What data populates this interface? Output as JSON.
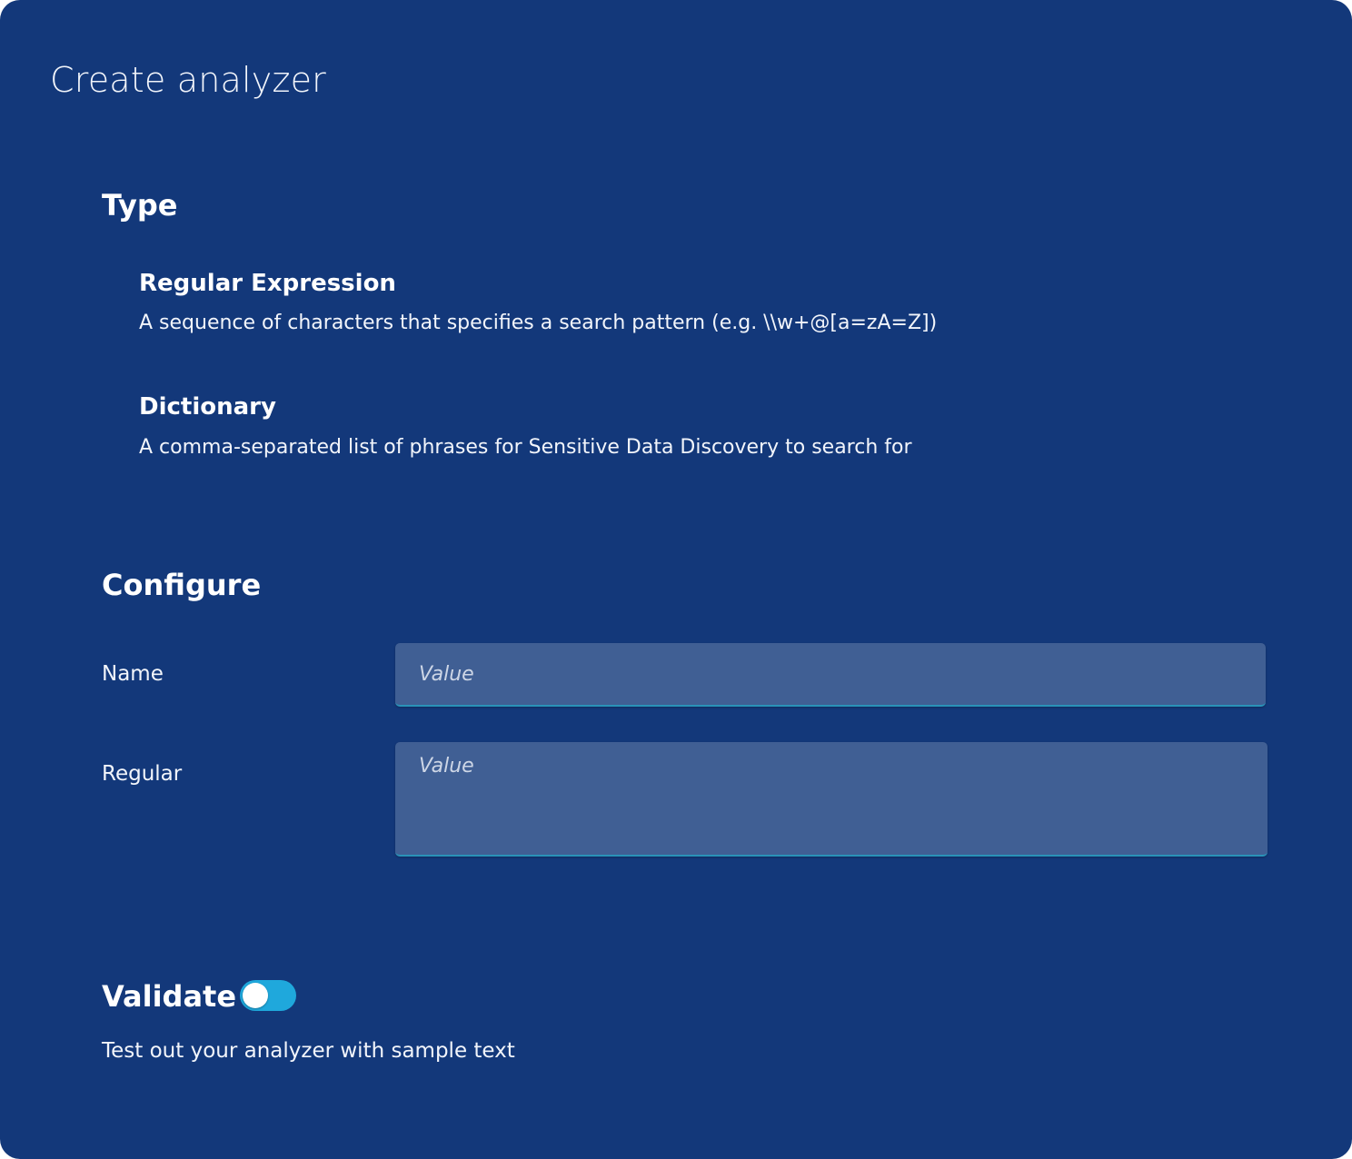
{
  "page": {
    "title": "Create analyzer"
  },
  "type_section": {
    "heading": "Type",
    "options": [
      {
        "title": "Regular Expression",
        "description": "A sequence of characters that specifies a search pattern (e.g. \\\\w+@[a=zA=Z])"
      },
      {
        "title": "Dictionary",
        "description": "A comma-separated list of phrases for Sensitive Data Discovery to search for"
      }
    ]
  },
  "configure_section": {
    "heading": "Configure",
    "name_field": {
      "label": "Name",
      "value": "",
      "placeholder": "Value"
    },
    "regular_field": {
      "label": "Regular",
      "value": "",
      "placeholder": "Value"
    }
  },
  "validate_section": {
    "heading": "Validate",
    "toggle_on": false,
    "description": "Test out your analyzer with sample text"
  },
  "colors": {
    "background": "#13387a",
    "input_background": "#405f94",
    "input_underline": "#2a93b8",
    "toggle_track": "#1fa8dc"
  },
  "icons": {
    "validate_toggle": "toggle-switch"
  }
}
